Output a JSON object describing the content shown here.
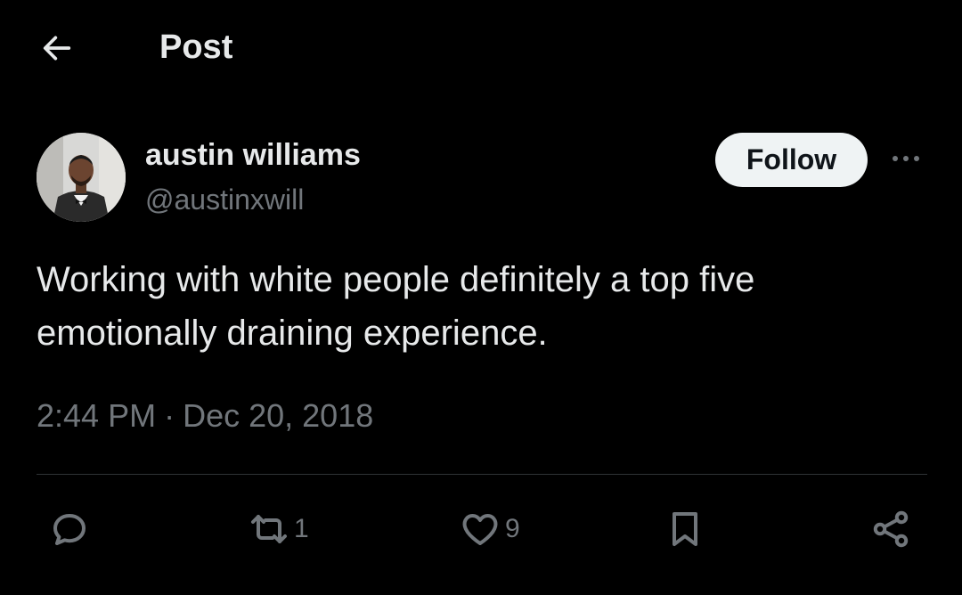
{
  "header": {
    "title": "Post",
    "back_icon": "arrow-left-icon"
  },
  "author": {
    "display_name": "austin williams",
    "handle": "@austinxwill",
    "avatar_icon": "avatar-photo"
  },
  "follow_label": "Follow",
  "more_icon": "more-horizontal-icon",
  "post": {
    "text": "Working with white people definitely a top five\nemotionally draining experience.",
    "time": "2:44 PM",
    "separator": "·",
    "date": "Dec 20, 2018"
  },
  "actions": {
    "reply": {
      "icon": "reply-icon",
      "count": ""
    },
    "repost": {
      "icon": "repost-icon",
      "count": "1"
    },
    "like": {
      "icon": "heart-icon",
      "count": "9"
    },
    "bookmark": {
      "icon": "bookmark-icon"
    },
    "share": {
      "icon": "share-icon"
    }
  },
  "colors": {
    "background": "#000000",
    "text_primary": "#e7e9ea",
    "text_secondary": "#71767b",
    "follow_bg": "#eff3f4",
    "divider": "#2f3336"
  }
}
